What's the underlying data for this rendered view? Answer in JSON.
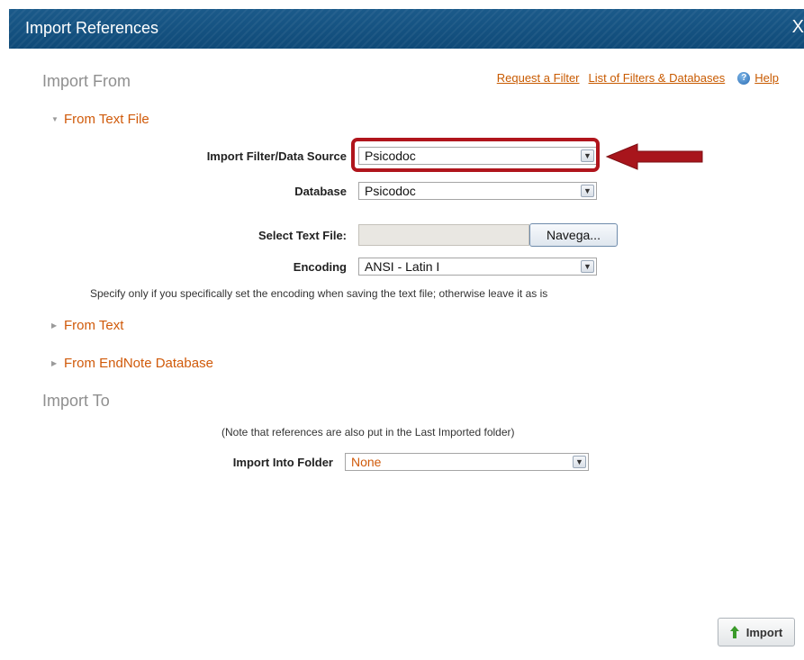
{
  "window": {
    "title": "Import References",
    "close_label": "X"
  },
  "import_from": {
    "heading": "Import From",
    "links": {
      "request_filter": "Request a Filter",
      "filters_databases": "List of Filters & Databases",
      "help": "Help"
    },
    "from_text_file": {
      "label": "From Text File",
      "filter_label": "Import Filter/Data Source",
      "filter_value": "Psicodoc",
      "database_label": "Database",
      "database_value": "Psicodoc",
      "select_file_label": "Select Text File:",
      "browse_label": "Navega...",
      "encoding_label": "Encoding",
      "encoding_value": "ANSI - Latin I",
      "encoding_note": "Specify only if you specifically set the encoding when saving the text file; otherwise leave it as is"
    },
    "from_text": {
      "label": "From Text"
    },
    "from_endnote": {
      "label": "From EndNote Database"
    }
  },
  "import_to": {
    "heading": "Import To",
    "note": "(Note that references are also put in the Last Imported folder)",
    "folder_label": "Import Into Folder",
    "folder_value": "None"
  },
  "import_button": {
    "label": "Import"
  },
  "colors": {
    "titlebar": "#1b5a8a",
    "link": "#c85a00",
    "expander": "#d05a0a",
    "highlight": "#b0151c",
    "arrow": "#a8151c",
    "folder_value": "#d05a0a",
    "import_arrow": "#3a9a2a"
  }
}
